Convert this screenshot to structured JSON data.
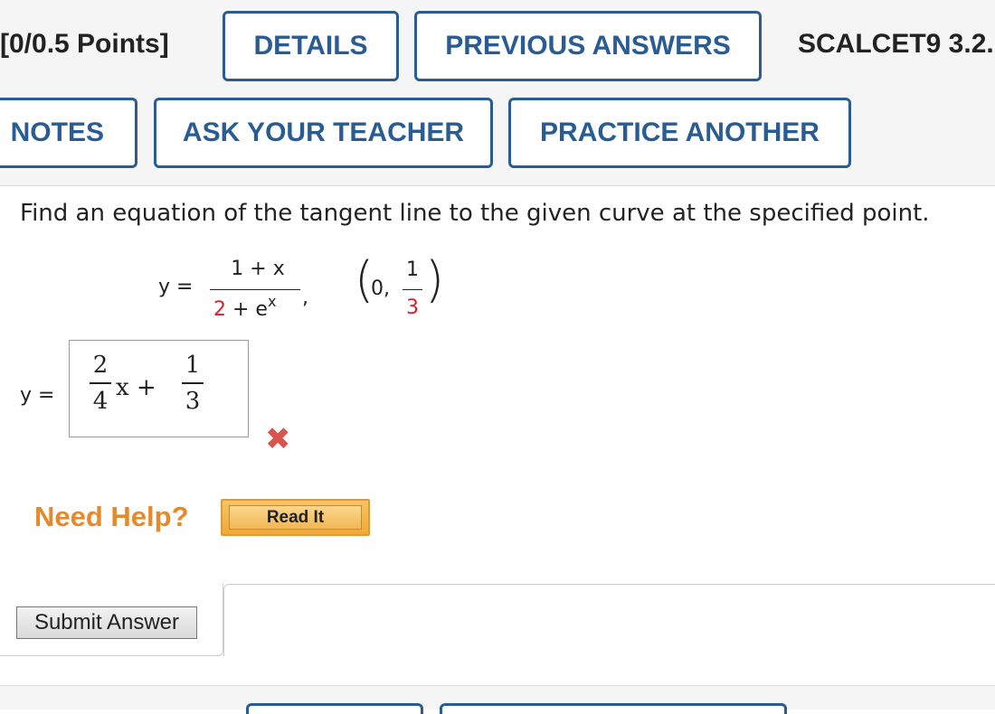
{
  "header": {
    "points": "[0/0.5 Points]",
    "details_label": "DETAILS",
    "previous_answers_label": "PREVIOUS ANSWERS",
    "course_code": "SCALCET9 3.2.",
    "notes_label": "NOTES",
    "ask_teacher_label": "ASK YOUR TEACHER",
    "practice_another_label": "PRACTICE ANOTHER"
  },
  "question": {
    "prompt": "Find an equation of the tangent line to the given curve at the specified point.",
    "y_label": "y =",
    "numerator": "1 + x",
    "denominator_const": "2",
    "denominator_rest": " + e",
    "denominator_exp": "x",
    "comma": ",",
    "point_x": "0,",
    "point_num": "1",
    "point_den": "3"
  },
  "answer": {
    "label": "y =",
    "frac1_num": "2",
    "frac1_den": "4",
    "middle": "x +",
    "frac2_num": "1",
    "frac2_den": "3",
    "status": "incorrect"
  },
  "help": {
    "need_help_label": "Need Help?",
    "read_it_label": "Read It"
  },
  "submit": {
    "label": "Submit Answer"
  },
  "colors": {
    "accent": "#2a5c94",
    "error": "#d9534f",
    "help": "#e48a2c"
  }
}
